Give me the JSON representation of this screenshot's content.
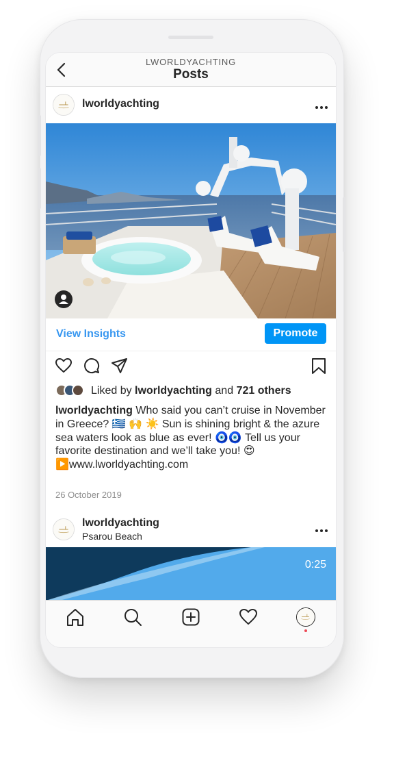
{
  "header": {
    "subtitle": "LWORLDYACHTING",
    "title": "Posts"
  },
  "post": {
    "username": "lworldyachting",
    "view_insights_label": "View Insights",
    "promote_label": "Promote",
    "likes": {
      "prefix": "Liked by",
      "user": "lworldyachting",
      "joiner": "and",
      "others": "721 others"
    },
    "caption": {
      "username": "lworldyachting",
      "line1": "Who said you can’t cruise in November in Greece? 🇬🇷 🙌 ☀️ Sun is shining bright & the azure sea waters look as blue as ever! 🧿🧿 Tell us your favorite destination and we’ll take you! 😍",
      "link": "▶️www.lworldyachting.com"
    },
    "date": "26 October 2019"
  },
  "next_post": {
    "username": "lworldyachting",
    "location": "Psarou Beach",
    "duration": "0:25"
  },
  "icons": {
    "back": "chevron-left-icon",
    "more": "more-horizontal-icon",
    "tag": "user-tag-icon",
    "like": "heart-outline-icon",
    "comment": "comment-bubble-icon",
    "share": "paper-plane-icon",
    "save": "bookmark-icon",
    "tabs": [
      "home-icon",
      "search-icon",
      "add-post-icon",
      "activity-heart-icon",
      "profile-avatar-icon"
    ]
  },
  "colors": {
    "link_blue": "#3897f0",
    "promote_blue": "#0095f6",
    "text": "#262626",
    "muted": "#8e8e8e",
    "notification": "#ed4956"
  }
}
